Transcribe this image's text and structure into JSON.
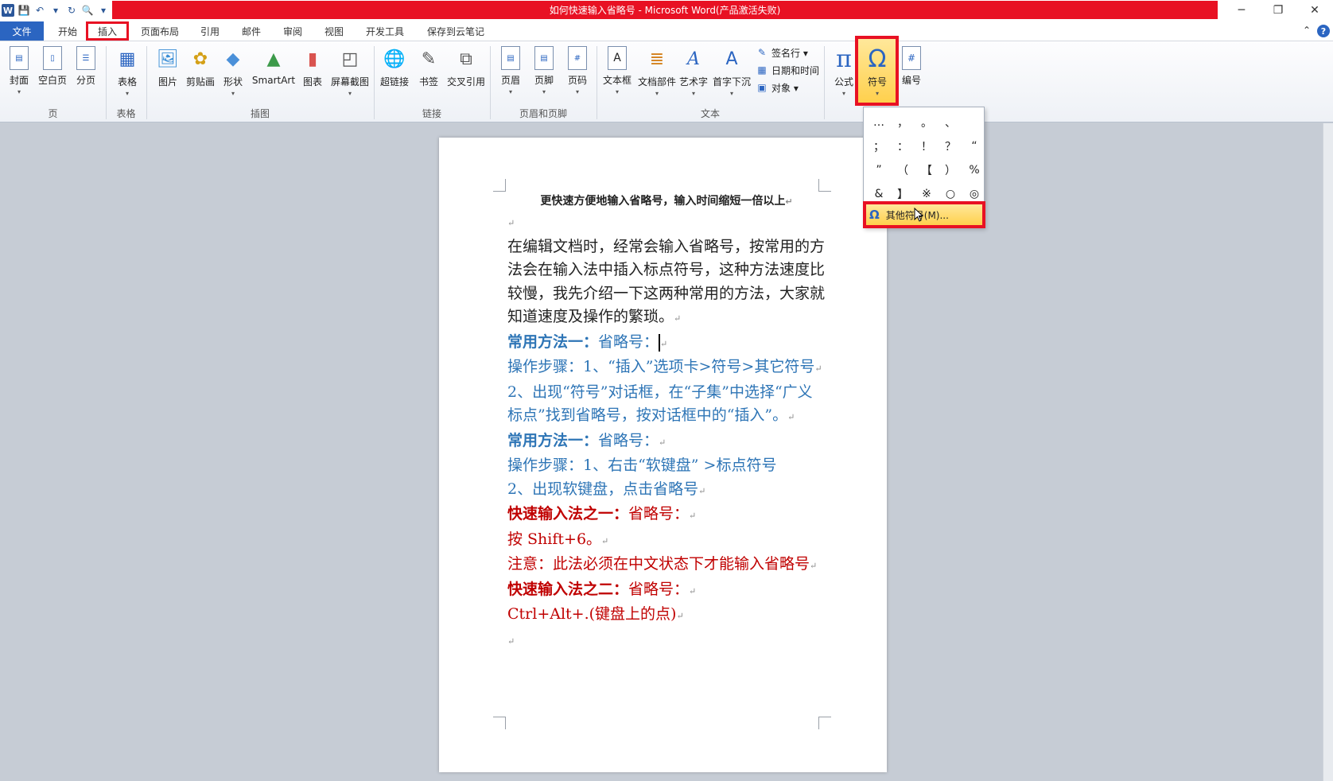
{
  "titlebar": {
    "title": "如何快速输入省略号 - Microsoft Word(产品激活失败)",
    "qat": [
      "W",
      "💾",
      "↶",
      "▾",
      "↻",
      "🔍",
      "▾"
    ],
    "win": [
      "─",
      "❐",
      "✕"
    ]
  },
  "tabs": {
    "file": "文件",
    "items": [
      "开始",
      "插入",
      "页面布局",
      "引用",
      "邮件",
      "审阅",
      "视图",
      "开发工具",
      "保存到云笔记"
    ],
    "active_index": 1,
    "collapse": "⌃",
    "help": "?"
  },
  "ribbon": {
    "buttons": [
      {
        "label": "封面",
        "icon": "cover-page-icon",
        "glyph": "▤"
      },
      {
        "label": "空白页",
        "icon": "blank-page-icon",
        "glyph": "▯"
      },
      {
        "label": "分页",
        "icon": "page-break-icon",
        "glyph": "☰"
      },
      {
        "label": "表格",
        "icon": "table-icon",
        "glyph": "▦"
      },
      {
        "label": "图片",
        "icon": "picture-icon",
        "glyph": "🖼"
      },
      {
        "label": "剪贴画",
        "icon": "clip-art-icon",
        "glyph": "✿"
      },
      {
        "label": "形状",
        "icon": "shapes-icon",
        "glyph": "◆"
      },
      {
        "label": "SmartArt",
        "icon": "smartart-icon",
        "glyph": "▲"
      },
      {
        "label": "图表",
        "icon": "chart-icon",
        "glyph": "▮"
      },
      {
        "label": "屏幕截图",
        "icon": "screenshot-icon",
        "glyph": "◰"
      },
      {
        "label": "超链接",
        "icon": "hyperlink-icon",
        "glyph": "🌐"
      },
      {
        "label": "书签",
        "icon": "bookmark-icon",
        "glyph": "✎"
      },
      {
        "label": "交叉引用",
        "icon": "cross-reference-icon",
        "glyph": "⧉"
      },
      {
        "label": "页眉",
        "icon": "header-icon",
        "glyph": "▤"
      },
      {
        "label": "页脚",
        "icon": "footer-icon",
        "glyph": "▤"
      },
      {
        "label": "页码",
        "icon": "page-number-icon",
        "glyph": "#"
      },
      {
        "label": "文本框",
        "icon": "textbox-icon",
        "glyph": "A"
      },
      {
        "label": "文档部件",
        "icon": "quick-parts-icon",
        "glyph": "≣"
      },
      {
        "label": "艺术字",
        "icon": "wordart-icon",
        "glyph": "A"
      },
      {
        "label": "首字下沉",
        "icon": "drop-cap-icon",
        "glyph": "A"
      },
      {
        "label": "公式",
        "icon": "equation-icon",
        "glyph": "π"
      },
      {
        "label": "符号",
        "icon": "omega-icon",
        "glyph": "Ω"
      },
      {
        "label": "编号",
        "icon": "numbering-icon",
        "glyph": "#"
      }
    ],
    "small": [
      {
        "label": "签名行 ▾",
        "icon": "signature-line-icon",
        "glyph": "✎"
      },
      {
        "label": "日期和时间",
        "icon": "date-time-icon",
        "glyph": "▦"
      },
      {
        "label": "对象 ▾",
        "icon": "object-icon",
        "glyph": "▣"
      }
    ],
    "groups": [
      "页",
      "表格",
      "插图",
      "链接",
      "页眉和页脚",
      "文本"
    ]
  },
  "document": {
    "title": "更快速方便地输入省略号，输入时间缩短一倍以上",
    "para_mark": "↵",
    "intro": "在编辑文档时，经常会输入省略号，按常用的方法会在输入法中插入标点符号，这种方法速度比较慢，我先介绍一下这两种常用的方法，大家就知道速度及操作的繁琐。",
    "m1_head": "常用方法一：",
    "m1_rest": "省略号：",
    "m1_step1": "操作步骤：1、“插入”选项卡>符号>其它符号",
    "m1_step2": "2、出现“符号”对话框，在“子集”中选择“广义标点”找到省略号，按对话框中的“插入”。",
    "m2_head": "常用方法一：",
    "m2_rest": "省略号：",
    "m2_step1": "操作步骤：1、右击“软键盘” >标点符号",
    "m2_step2": "2、出现软键盘，点击省略号",
    "f1_head": "快速输入法之一：",
    "f1_rest": "省略号：",
    "f1_line": "按 Shift+6。",
    "f1_note": "注意：此法必须在中文状态下才能输入省略号",
    "f2_head": "快速输入法之二：",
    "f2_rest": "省略号：",
    "f2_line": "Ctrl+Alt+.(键盘上的点)"
  },
  "symbol_menu": {
    "symbols": [
      "…",
      "，",
      "。",
      "、",
      "",
      "；",
      "：",
      "！",
      "？",
      "“",
      "”",
      "（",
      "【",
      "）",
      "%",
      "&",
      "】",
      "※",
      "○",
      "◎"
    ],
    "more_label": "其他符号(M)...",
    "more_icon": "Ω"
  },
  "colors": {
    "title_red": "#e81123",
    "highlight": "#e81123",
    "blue_text": "#2e75b6",
    "red_text": "#c00000"
  }
}
